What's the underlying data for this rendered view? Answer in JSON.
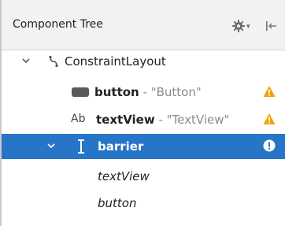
{
  "header": {
    "title": "Component Tree"
  },
  "tree": {
    "root": {
      "label": "ConstraintLayout"
    },
    "button": {
      "id": "button",
      "sep": " - ",
      "text": "\"Button\""
    },
    "textView": {
      "prefix": "Ab",
      "id": "textView",
      "sep": " - ",
      "text": "\"TextView\""
    },
    "barrier": {
      "id": "barrier",
      "children": [
        "textView",
        "button"
      ]
    }
  },
  "colors": {
    "selection": "#2675c6",
    "warning": "#f0a30a",
    "header_bg": "#f2f2f2"
  }
}
